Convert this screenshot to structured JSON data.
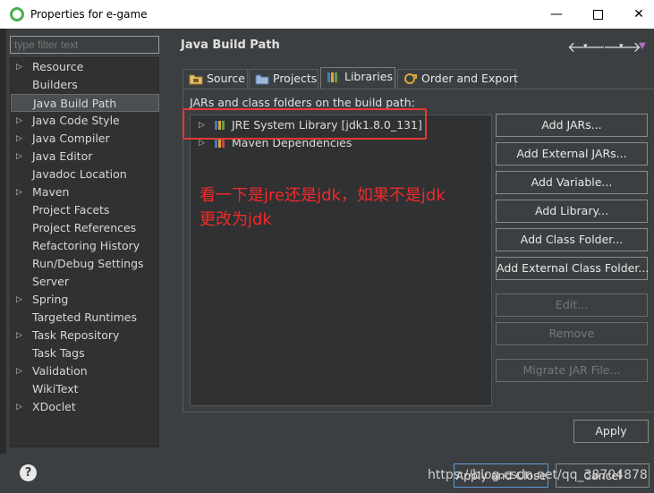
{
  "window": {
    "title": "Properties for e-game"
  },
  "filter": {
    "placeholder": "type filter text"
  },
  "sidebar": {
    "items": [
      {
        "label": "Resource",
        "expandable": true
      },
      {
        "label": "Builders",
        "expandable": false
      },
      {
        "label": "Java Build Path",
        "expandable": false,
        "selected": true
      },
      {
        "label": "Java Code Style",
        "expandable": true
      },
      {
        "label": "Java Compiler",
        "expandable": true
      },
      {
        "label": "Java Editor",
        "expandable": true
      },
      {
        "label": "Javadoc Location",
        "expandable": false
      },
      {
        "label": "Maven",
        "expandable": true
      },
      {
        "label": "Project Facets",
        "expandable": false
      },
      {
        "label": "Project References",
        "expandable": false
      },
      {
        "label": "Refactoring History",
        "expandable": false
      },
      {
        "label": "Run/Debug Settings",
        "expandable": false
      },
      {
        "label": "Server",
        "expandable": false
      },
      {
        "label": "Spring",
        "expandable": true
      },
      {
        "label": "Targeted Runtimes",
        "expandable": false
      },
      {
        "label": "Task Repository",
        "expandable": true
      },
      {
        "label": "Task Tags",
        "expandable": false
      },
      {
        "label": "Validation",
        "expandable": true
      },
      {
        "label": "WikiText",
        "expandable": false
      },
      {
        "label": "XDoclet",
        "expandable": true
      }
    ]
  },
  "pane": {
    "title": "Java Build Path"
  },
  "tabs": [
    {
      "label": "Source",
      "icon": "source-folder-icon"
    },
    {
      "label": "Projects",
      "icon": "projects-icon"
    },
    {
      "label": "Libraries",
      "icon": "libraries-icon",
      "active": true
    },
    {
      "label": "Order and Export",
      "icon": "order-export-icon"
    }
  ],
  "libraries": {
    "caption": "JARs and class folders on the build path:",
    "entries": [
      {
        "label": "JRE System Library [jdk1.8.0_131]"
      },
      {
        "label": "Maven Dependencies"
      }
    ]
  },
  "buttons": [
    {
      "label": "Add JARs...",
      "enabled": true
    },
    {
      "label": "Add External JARs...",
      "enabled": true
    },
    {
      "label": "Add Variable...",
      "enabled": true
    },
    {
      "label": "Add Library...",
      "enabled": true
    },
    {
      "label": "Add Class Folder...",
      "enabled": true
    },
    {
      "label": "Add External Class Folder...",
      "enabled": true
    },
    {
      "label": "Edit...",
      "enabled": false
    },
    {
      "label": "Remove",
      "enabled": false
    },
    {
      "label": "Migrate JAR File...",
      "enabled": false
    }
  ],
  "annotation": {
    "line1": "看一下是jre还是jdk，如果不是jdk",
    "line2": "更改为jdk"
  },
  "apply_label": "Apply",
  "footer": {
    "apply_close_label": "Apply and Close",
    "cancel_label": "Cancel",
    "watermark": "https://blog.csdn.net/qq_38704878"
  },
  "colors": {
    "annotation_red": "#f02a2a",
    "highlight_border": "#e53935",
    "background": "#3c3f41"
  }
}
